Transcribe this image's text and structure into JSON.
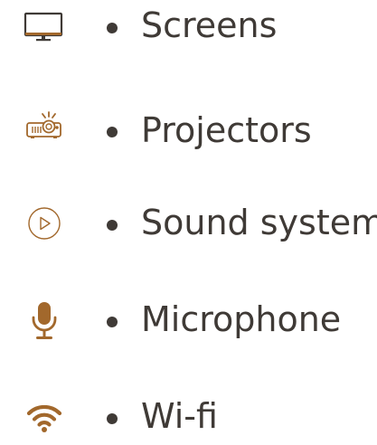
{
  "colors": {
    "icon_accent": "#a2682c",
    "icon_dark": "#3f3a36",
    "text": "#3f3a36"
  },
  "items": [
    {
      "label": "Screens",
      "icon": "monitor-icon"
    },
    {
      "label": "Projectors",
      "icon": "projector-icon"
    },
    {
      "label": "Sound system",
      "icon": "play-circle-icon"
    },
    {
      "label": "Microphone",
      "icon": "microphone-icon"
    },
    {
      "label": "Wi-fi",
      "icon": "wifi-icon"
    }
  ]
}
